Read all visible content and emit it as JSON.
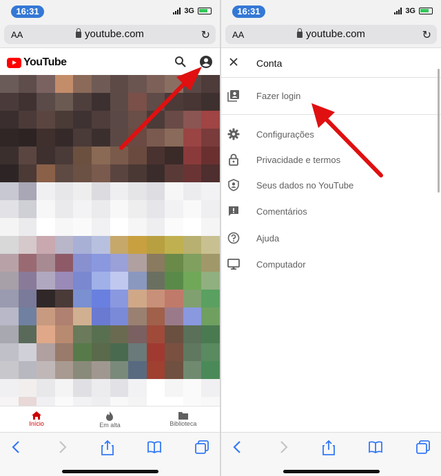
{
  "left": {
    "status": {
      "time": "16:31",
      "network": "3G"
    },
    "url_bar": {
      "text_size": "AA",
      "url": "youtube.com"
    },
    "youtube": {
      "logo_text": "YouTube"
    },
    "tabs": [
      {
        "label": "Início",
        "icon": "home-icon",
        "active": true
      },
      {
        "label": "Em alta",
        "icon": "flame-icon",
        "active": false
      },
      {
        "label": "Biblioteca",
        "icon": "folder-icon",
        "active": false
      }
    ]
  },
  "right": {
    "status": {
      "time": "16:31",
      "network": "3G"
    },
    "url_bar": {
      "text_size": "AA",
      "url": "youtube.com"
    },
    "menu": {
      "title": "Conta",
      "login": "Fazer login",
      "items": [
        {
          "label": "Configurações",
          "icon": "gear-icon"
        },
        {
          "label": "Privacidade e termos",
          "icon": "lock-icon"
        },
        {
          "label": "Seus dados no YouTube",
          "icon": "shield-person-icon"
        },
        {
          "label": "Comentários",
          "icon": "feedback-icon"
        },
        {
          "label": "Ajuda",
          "icon": "help-icon"
        },
        {
          "label": "Computador",
          "icon": "desktop-icon"
        }
      ]
    }
  },
  "colors": {
    "youtube_red": "#ff0000",
    "annotation_arrow": "#e01010",
    "time_pill": "#3478d6",
    "active_tab": "#cc0000",
    "ios_blue": "#3478f6"
  }
}
